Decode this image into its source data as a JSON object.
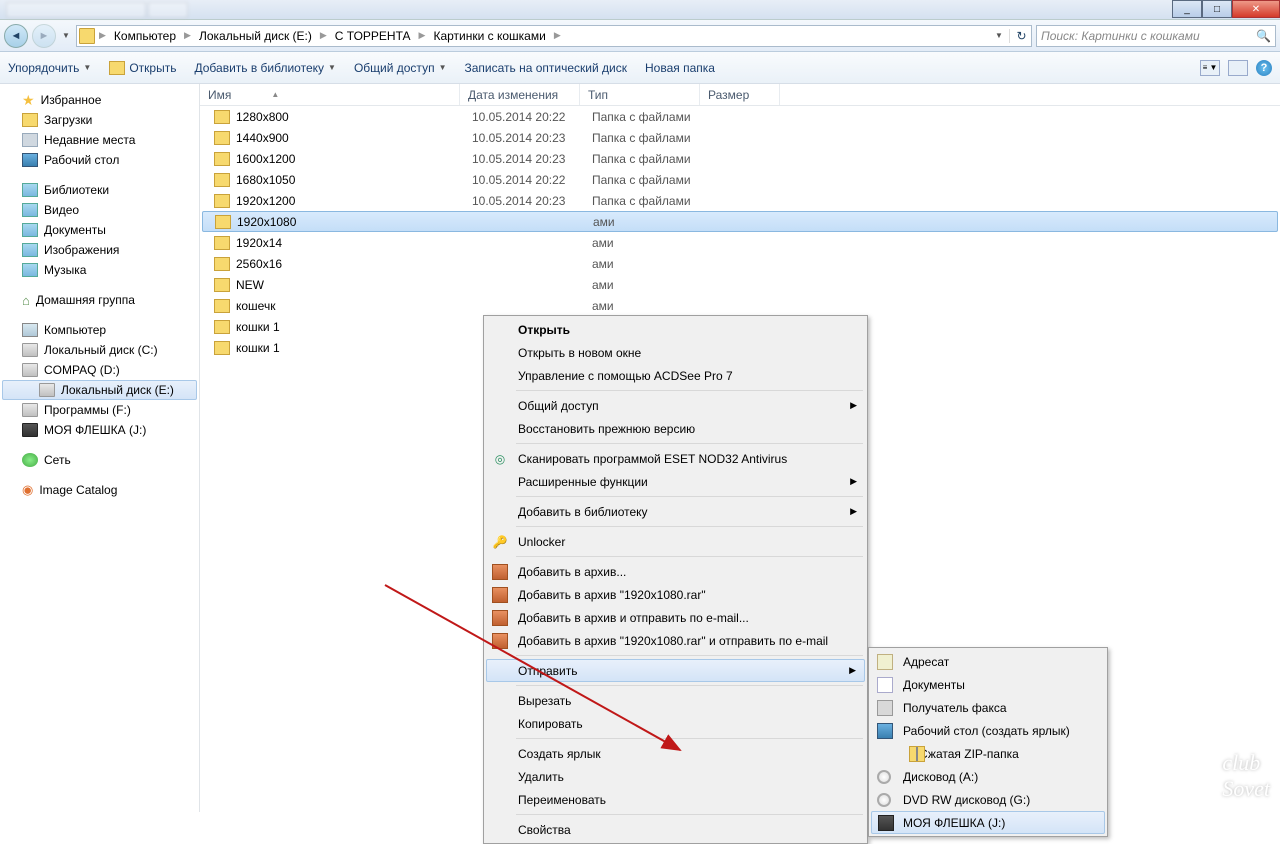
{
  "window": {
    "min": "_",
    "max": "□",
    "close": "✕"
  },
  "breadcrumb": {
    "items": [
      "Компьютер",
      "Локальный диск (E:)",
      "С ТОРРЕНТА",
      "Картинки с кошками"
    ]
  },
  "search": {
    "placeholder": "Поиск: Картинки с кошками"
  },
  "toolbar": {
    "organize": "Упорядочить",
    "open": "Открыть",
    "library": "Добавить в библиотеку",
    "share": "Общий доступ",
    "burn": "Записать на оптический диск",
    "newfolder": "Новая папка"
  },
  "sidebar": {
    "favorites": "Избранное",
    "downloads": "Загрузки",
    "recent": "Недавние места",
    "desktop": "Рабочий стол",
    "libraries": "Библиотеки",
    "video": "Видео",
    "documents": "Документы",
    "pictures": "Изображения",
    "music": "Музыка",
    "homegroup": "Домашняя группа",
    "computer": "Компьютер",
    "drive_c": "Локальный диск (C:)",
    "drive_d": "COMPAQ (D:)",
    "drive_e": "Локальный диск (E:)",
    "drive_f": "Программы  (F:)",
    "drive_j": "МОЯ ФЛЕШКА (J:)",
    "network": "Сеть",
    "imagecatalog": "Image Catalog"
  },
  "columns": {
    "name": "Имя",
    "date": "Дата изменения",
    "type": "Тип",
    "size": "Размер"
  },
  "files": [
    {
      "name": "1280x800",
      "date": "10.05.2014 20:22",
      "type": "Папка с файлами"
    },
    {
      "name": "1440x900",
      "date": "10.05.2014 20:23",
      "type": "Папка с файлами"
    },
    {
      "name": "1600x1200",
      "date": "10.05.2014 20:23",
      "type": "Папка с файлами"
    },
    {
      "name": "1680x1050",
      "date": "10.05.2014 20:22",
      "type": "Папка с файлами"
    },
    {
      "name": "1920x1200",
      "date": "10.05.2014 20:23",
      "type": "Папка с файлами"
    },
    {
      "name": "1920x1080",
      "date": "",
      "type": "ами"
    },
    {
      "name": "1920x14",
      "date": "",
      "type": "ами"
    },
    {
      "name": "2560x16",
      "date": "",
      "type": "ами"
    },
    {
      "name": "NEW",
      "date": "",
      "type": "ами"
    },
    {
      "name": "кошечк",
      "date": "",
      "type": "ами"
    },
    {
      "name": "кошки 1",
      "date": "",
      "type": "ами"
    },
    {
      "name": "кошки 1",
      "date": "",
      "type": "ами"
    }
  ],
  "ctx": {
    "open": "Открыть",
    "open_new": "Открыть в новом окне",
    "acdsee": "Управление с помощью ACDSee Pro 7",
    "share": "Общий доступ",
    "restore": "Восстановить прежнюю версию",
    "eset": "Сканировать программой ESET NOD32 Antivirus",
    "advanced": "Расширенные функции",
    "addlib": "Добавить в библиотеку",
    "unlocker": "Unlocker",
    "archive1": "Добавить в архив...",
    "archive2": "Добавить в архив \"1920x1080.rar\"",
    "archive3": "Добавить в архив и отправить по e-mail...",
    "archive4": "Добавить в архив \"1920x1080.rar\" и отправить по e-mail",
    "sendto": "Отправить",
    "cut": "Вырезать",
    "copy": "Копировать",
    "shortcut": "Создать ярлык",
    "delete": "Удалить",
    "rename": "Переименовать",
    "properties": "Свойства"
  },
  "sub": {
    "recipient": "Адресат",
    "documents": "Документы",
    "fax": "Получатель факса",
    "desktop": "Рабочий стол (создать ярлык)",
    "zip": "Сжатая ZIP-папка",
    "drive_a": "Дисковод (A:)",
    "drive_g": "DVD RW дисковод (G:)",
    "drive_j": "МОЯ ФЛЕШКА (J:)"
  },
  "watermark": "club\nSovet"
}
